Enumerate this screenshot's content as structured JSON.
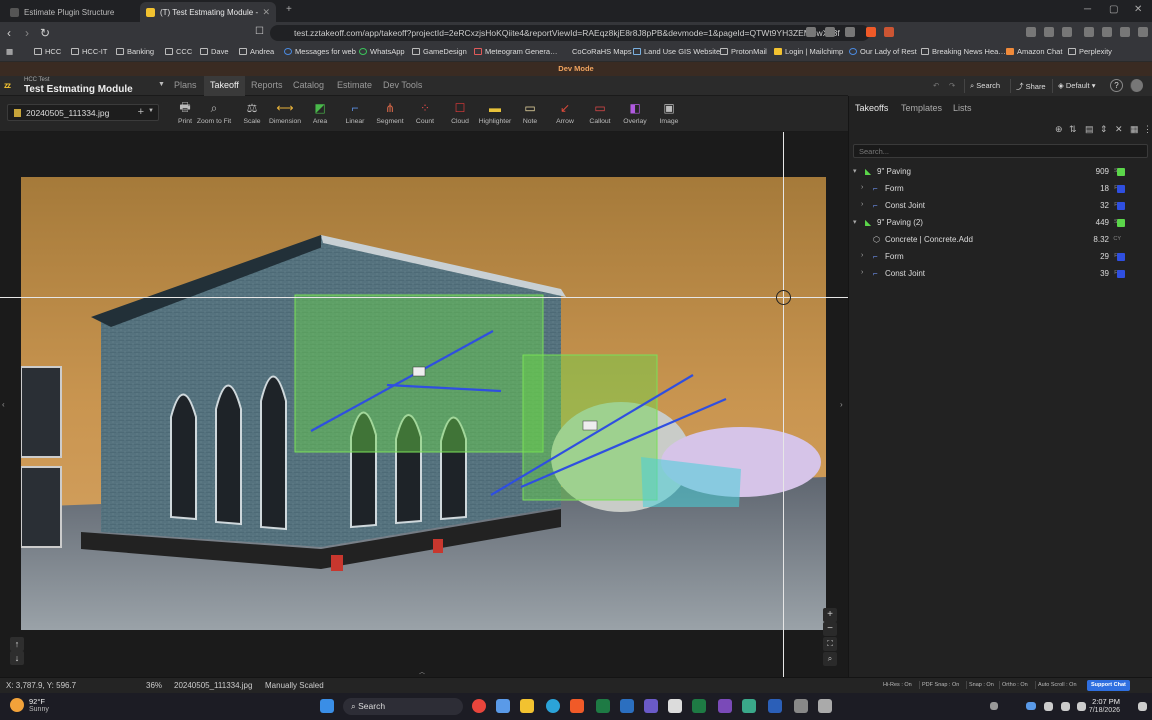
{
  "browser": {
    "tabs": [
      {
        "title": "Estimate Plugin Structure"
      },
      {
        "title": "(T) Test Estmating Module - 202…"
      }
    ],
    "url": "test.zztakeoff.com/app/takeoff?projectId=2eRCxzjsHoKQiite4&reportViewId=RAEqz8kjE8r8J8pPB&devmode=1&pageId=QTWt9YH3ZEMSwXx3f",
    "bookmarks": [
      "HCC",
      "HCC-IT",
      "Banking",
      "CCC",
      "Dave",
      "Andrea",
      "Messages for web",
      "WhatsApp",
      "GameDesign",
      "Meteogram Genera…",
      "CoCoRaHS Maps",
      "Land Use GIS Website",
      "ProtonMail",
      "Login | Mailchimp",
      "Our Lady of Rest",
      "Breaking News Hea…",
      "Amazon Chat",
      "Perplexity"
    ]
  },
  "dev_banner": "Dev Mode",
  "app": {
    "logo": "zz",
    "org": "HCC Test",
    "project": "Test Estmating Module",
    "tabs": [
      "Plans",
      "Takeoff",
      "Reports",
      "Catalog",
      "Estimate",
      "Dev Tools"
    ],
    "active_tab": "Takeoff",
    "header_buttons": {
      "search": "Search",
      "share": "Share",
      "default": "Default"
    }
  },
  "toolbar": {
    "file": "20240505_111334.jpg",
    "tools": [
      {
        "label": "Print",
        "icon": "printer-icon",
        "color": "#bbbbbb"
      },
      {
        "label": "Zoom to Fit",
        "icon": "zoom-fit-icon",
        "color": "#bbbbbb"
      },
      {
        "label": "Scale",
        "icon": "scale-icon",
        "color": "#bbbbbb"
      },
      {
        "label": "Dimension",
        "icon": "dimension-icon",
        "color": "#e8b23a"
      },
      {
        "label": "Area",
        "icon": "area-icon",
        "color": "#49b84a"
      },
      {
        "label": "Linear",
        "icon": "linear-icon",
        "color": "#5b8de0"
      },
      {
        "label": "Segment",
        "icon": "segment-icon",
        "color": "#e06b4a"
      },
      {
        "label": "Count",
        "icon": "count-icon",
        "color": "#e04a4a"
      },
      {
        "label": "Cloud",
        "icon": "cloud-icon",
        "color": "#e03a3a"
      },
      {
        "label": "Highlighter",
        "icon": "highlighter-icon",
        "color": "#e8c23a"
      },
      {
        "label": "Note",
        "icon": "note-icon",
        "color": "#e8d8a0"
      },
      {
        "label": "Arrow",
        "icon": "arrow-icon",
        "color": "#e04a3a"
      },
      {
        "label": "Callout",
        "icon": "callout-icon",
        "color": "#e04a4a"
      },
      {
        "label": "Overlay",
        "icon": "overlay-icon",
        "color": "#b05ae0"
      },
      {
        "label": "Image",
        "icon": "image-icon",
        "color": "#bbbbbb"
      }
    ]
  },
  "right_panel": {
    "tabs": [
      "Takeoffs",
      "Templates",
      "Lists"
    ],
    "active_tab": "Takeoffs",
    "search_placeholder": "Search...",
    "tree": [
      {
        "label": "9\" Paving",
        "qty": "909",
        "unit": "SF",
        "color": "#5bd64a",
        "level": 0,
        "caret": "▾",
        "icon": "area-icon"
      },
      {
        "label": "Form",
        "qty": "18",
        "unit": "FT",
        "color": "#2f4fe0",
        "level": 1,
        "caret": "›",
        "icon": "linear-icon"
      },
      {
        "label": "Const Joint",
        "qty": "32",
        "unit": "FT",
        "color": "#2f4fe0",
        "level": 1,
        "caret": "›",
        "icon": "linear-icon"
      },
      {
        "label": "9\" Paving (2)",
        "qty": "449",
        "unit": "SF",
        "color": "#5bd64a",
        "level": 0,
        "caret": "▾",
        "icon": "area-icon"
      },
      {
        "label": "Concrete | Concrete.Add",
        "qty": "8.32",
        "unit": "CY",
        "color": "",
        "level": 1,
        "caret": "",
        "icon": "cube-icon"
      },
      {
        "label": "Form",
        "qty": "29",
        "unit": "FT",
        "color": "#2f4fe0",
        "level": 1,
        "caret": "›",
        "icon": "linear-icon"
      },
      {
        "label": "Const Joint",
        "qty": "39",
        "unit": "FT",
        "color": "#2f4fe0",
        "level": 1,
        "caret": "›",
        "icon": "linear-icon"
      }
    ]
  },
  "status": {
    "coords": "X: 3,787.9, Y: 596.7",
    "zoom": "36%",
    "file": "20240505_111334.jpg",
    "scale": "Manually Scaled",
    "toggles": [
      "Hi-Res : On",
      "PDF Snap : On",
      "Snap : On",
      "Ortho : On",
      "Auto Scroll : On"
    ],
    "support": "Support Chat"
  },
  "taskbar": {
    "temp": "92°F",
    "condition": "Sunny",
    "search": "Search",
    "time": "2:07 PM",
    "date": "7/18/2026"
  }
}
